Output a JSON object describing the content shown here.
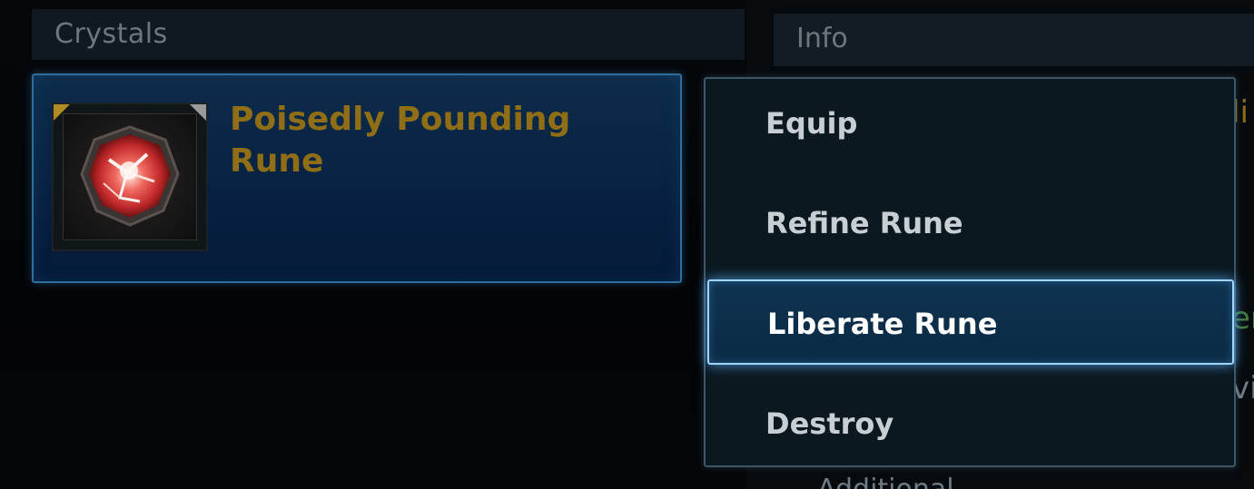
{
  "crystals_panel": {
    "title": "Crystals",
    "selected_item": {
      "name": "Poisedly Pounding Rune",
      "icon": "red-rune-crystal-icon"
    }
  },
  "info_panel": {
    "title": "Info",
    "peek_texts": [
      "li",
      "er",
      "vi"
    ],
    "bottom_peek_text": "Additional ..."
  },
  "context_menu": {
    "items": [
      {
        "label": "Equip"
      },
      {
        "label": "Refine Rune"
      },
      {
        "label": "Liberate Rune"
      },
      {
        "label": "Destroy"
      }
    ],
    "selected_index": 2
  },
  "colors": {
    "item_name": "#8f6e16",
    "selection_glow": "#9fd4ff",
    "peek_gold": "#8f6e16",
    "peek_green": "#3f7a3a"
  }
}
